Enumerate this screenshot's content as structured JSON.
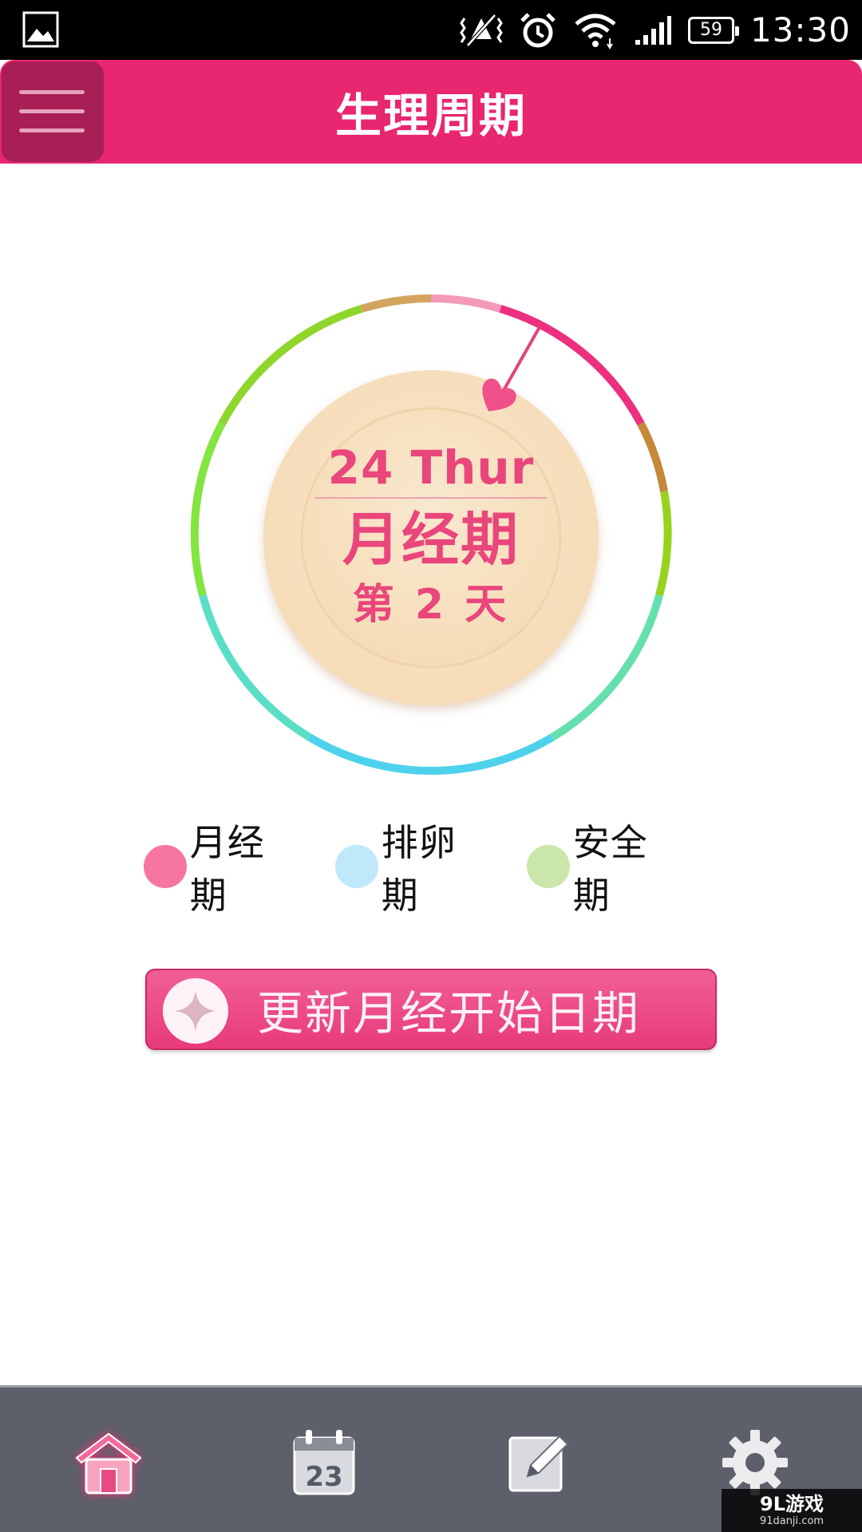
{
  "status_bar": {
    "time": "13:30",
    "battery": "59",
    "icons": [
      "image-icon",
      "vibrate-icon",
      "alarm-icon",
      "wifi-icon",
      "signal-icon",
      "battery-icon"
    ]
  },
  "app_bar": {
    "title": "生理周期"
  },
  "dial": {
    "date": "24 Thur",
    "phase": "月经期",
    "day": "第 2 天"
  },
  "legend": [
    {
      "label": "月经期",
      "color": "#f6769f"
    },
    {
      "label": "排卵期",
      "color": "#bfe8fb"
    },
    {
      "label": "安全期",
      "color": "#cbe6a9"
    }
  ],
  "update_button": {
    "label": "更新月经开始日期"
  },
  "bottom_nav": {
    "items": [
      "home-icon",
      "calendar-icon",
      "edit-icon",
      "settings-icon"
    ],
    "calendar_day": "23",
    "active": "home"
  },
  "watermark": {
    "main": "9L游戏",
    "sub": "91danji.com"
  },
  "colors": {
    "accent": "#e92670",
    "menu_bg": "#a81f55",
    "text_pink": "#e9467c",
    "nav_bg": "#5d5f6a"
  }
}
